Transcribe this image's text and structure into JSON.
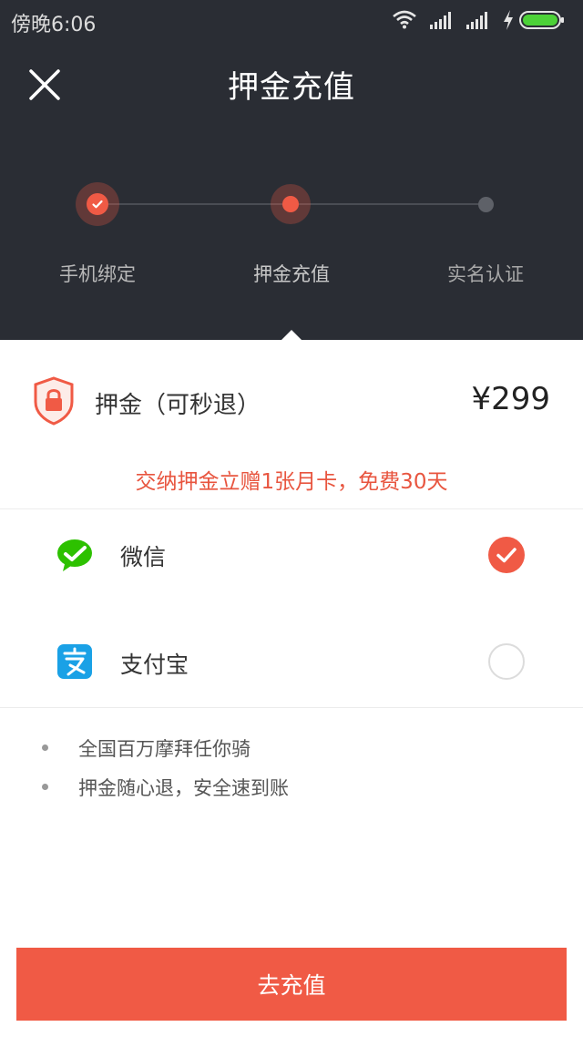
{
  "status_bar": {
    "time": "傍晚6:06",
    "icons": [
      "wifi-icon",
      "signal-icon",
      "signal-icon",
      "charging-icon",
      "battery-icon"
    ],
    "battery_color": "#4cd137"
  },
  "nav": {
    "title": "押金充值",
    "close_icon": "close-icon"
  },
  "steps": [
    {
      "label": "手机绑定",
      "state": "done"
    },
    {
      "label": "押金充值",
      "state": "active"
    },
    {
      "label": "实名认证",
      "state": "pending"
    }
  ],
  "deposit": {
    "icon": "shield-lock-icon",
    "label": "押金（可秒退）",
    "amount": "¥299",
    "promo": "交纳押金立赠1张月卡，免费30天"
  },
  "payment_methods": [
    {
      "label": "微信",
      "icon": "wechat-icon",
      "selected": true
    },
    {
      "label": "支付宝",
      "icon": "alipay-icon",
      "selected": false
    }
  ],
  "notes": [
    "全国百万摩拜任你骑",
    "押金随心退，安全速到账"
  ],
  "submit": {
    "label": "去充值"
  },
  "colors": {
    "header_bg": "#2a2d34",
    "accent": "#f05a45",
    "wechat": "#2dc100",
    "alipay": "#1aa1e6"
  }
}
